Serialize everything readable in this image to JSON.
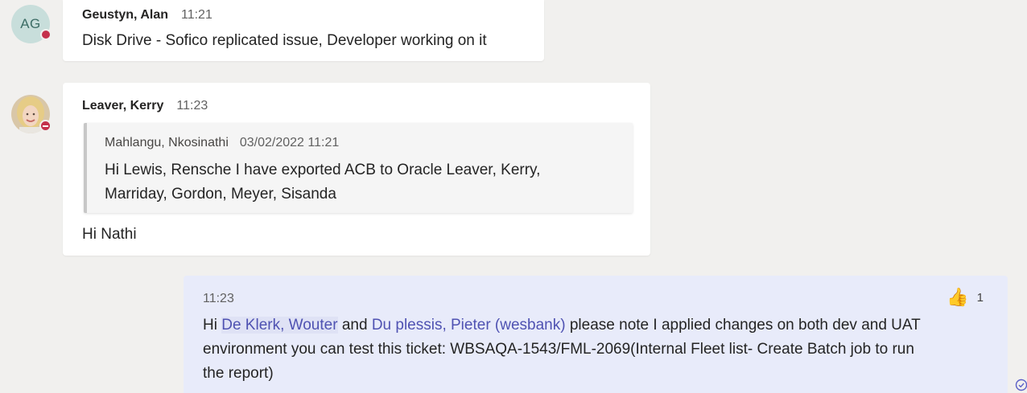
{
  "messages": [
    {
      "avatar_initials": "AG",
      "author": "Geustyn, Alan",
      "time": "11:21",
      "text": "Disk Drive - Sofico replicated issue, Developer working on it",
      "status": "busy"
    },
    {
      "author": "Leaver, Kerry",
      "time": "11:23",
      "status": "do-not-disturb",
      "quote": {
        "author": "Mahlangu, Nkosinathi",
        "timestamp": "03/02/2022 11:21",
        "line1": "Hi Lewis, Rensche I have exported ACB to Oracle Leaver, Kerry,",
        "line2": "Marriday, Gordon, Meyer, Sisanda"
      },
      "text": "Hi Nathi"
    }
  ],
  "own_message": {
    "time": "11:23",
    "reaction": {
      "emoji": "👍",
      "count": "1"
    },
    "greeting": "Hi",
    "mention1": "De Klerk, Wouter",
    "connector": "and",
    "mention2": "Du plessis, Pieter (wesbank)",
    "line1_rest": "please note I applied changes on both dev and UAT",
    "line2": "environment you can test this ticket: WBSAQA-1543/FML-2069(Internal Fleet list- Create Batch job to run",
    "line3": "the report)",
    "read_receipt_icon": "seen-check-icon"
  },
  "colors": {
    "background": "#f1f0ee",
    "bubble": "#ffffff",
    "own_bubble": "#e8ebfa",
    "mention": "#4f52b2",
    "busy_status": "#c4314b"
  }
}
